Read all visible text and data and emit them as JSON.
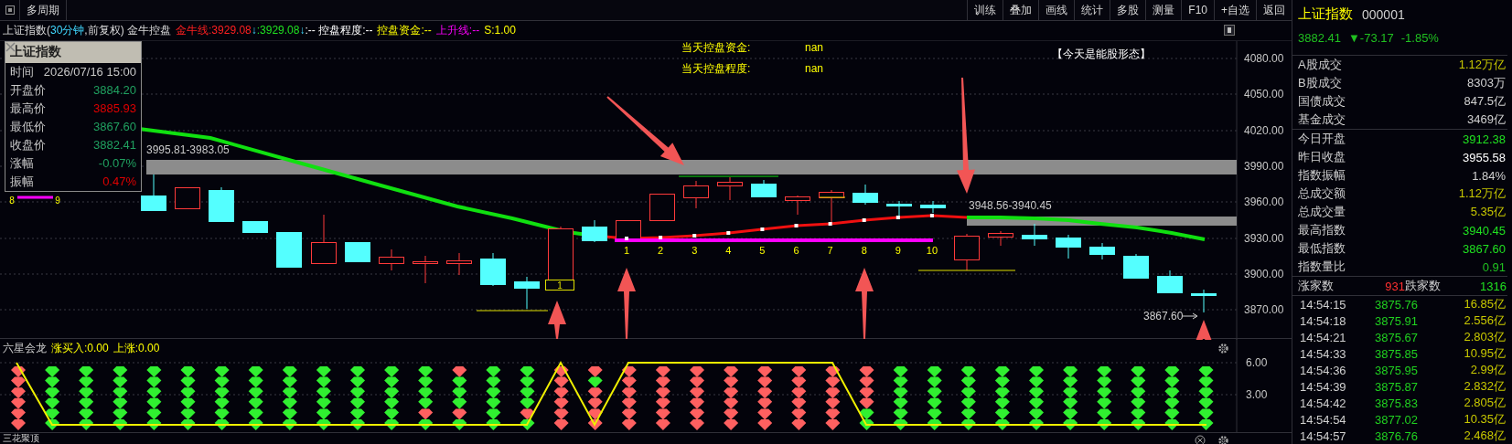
{
  "toolbar": {
    "left_buttons": [
      "多周期"
    ],
    "right_buttons": [
      "训练",
      "叠加",
      "画线",
      "统计",
      "多股",
      "测量",
      "F10",
      "+自选",
      "返回"
    ]
  },
  "chart_title": {
    "segments": [
      {
        "text": "上证指数(",
        "kind": "title"
      },
      {
        "text": "30分钟",
        "kind": "period"
      },
      {
        "text": ",前复权) 金牛控盘",
        "kind": "title"
      },
      {
        "text": "金牛线:3929.08",
        "kind": "line"
      },
      {
        "text": "↓",
        "kind": "arrow"
      },
      {
        "text": ":3929.08",
        "kind": "value"
      },
      {
        "text": "↓",
        "kind": "arrow"
      },
      {
        "text": ":-- 控盘程度:--",
        "kind": "plain"
      },
      {
        "text": "控盘资金:--",
        "kind": "fund"
      },
      {
        "text": "上升线:--",
        "kind": "rise"
      },
      {
        "text": "S:1.00",
        "kind": "fund"
      }
    ]
  },
  "info_box": {
    "title": "上证指数",
    "time_label": "时间",
    "time": "2026/07/16 15:00",
    "rows": [
      {
        "label": "开盘价",
        "value": "3884.20",
        "color": "#20a060"
      },
      {
        "label": "最高价",
        "value": "3885.93",
        "color": "#e00000"
      },
      {
        "label": "最低价",
        "value": "3867.60",
        "color": "#20a060"
      },
      {
        "label": "收盘价",
        "value": "3882.41",
        "color": "#20a060"
      },
      {
        "label": "涨幅",
        "value": "-0.07%",
        "color": "#20a060"
      },
      {
        "label": "振幅",
        "value": "0.47%",
        "color": "#e00000"
      }
    ]
  },
  "main_chart": {
    "notes": [
      {
        "label": "当天控盘资金:",
        "value": "nan"
      },
      {
        "label": "当天控盘程度:",
        "value": "nan"
      }
    ],
    "pattern_note": "【今天是能股形态】",
    "range_labels": [
      "3995.81-3983.05",
      "3948.56-3940.45"
    ],
    "low_label": "3867.60",
    "count_labels": [
      "1",
      "2",
      "3",
      "4",
      "5",
      "6",
      "7",
      "8",
      "9",
      "10"
    ],
    "box_label": "1",
    "side_labels": [
      "8",
      "9"
    ],
    "y_axis": [
      "4080.00",
      "4050.00",
      "4020.00",
      "3990.00",
      "3960.00",
      "3930.00",
      "3900.00",
      "3870.00"
    ]
  },
  "indicator": {
    "name": "六星会龙",
    "values": [
      "涨买入:0.00",
      "上涨:0.00"
    ],
    "y_axis": [
      "6.00",
      "3.00"
    ]
  },
  "next_indicator": {
    "name": "三花聚顶"
  },
  "quote_panel": {
    "name": "上证指数",
    "code": "000001",
    "price": "3882.41",
    "change": "▼-73.17",
    "percent": "-1.85%",
    "groups": [
      [
        {
          "label": "A股成交",
          "value": "1.12万亿",
          "color": "#c8c800"
        },
        {
          "label": "B股成交",
          "value": "8303万",
          "color": "#d0d0d0"
        },
        {
          "label": "国债成交",
          "value": "847.5亿",
          "color": "#d0d0d0"
        },
        {
          "label": "基金成交",
          "value": "3469亿",
          "color": "#d0d0d0"
        }
      ],
      [
        {
          "label": "今日开盘",
          "value": "3912.38",
          "color": "#20e020"
        },
        {
          "label": "昨日收盘",
          "value": "3955.58",
          "color": "#ffffff"
        },
        {
          "label": "指数振幅",
          "value": "1.84%",
          "color": "#d0d0d0"
        },
        {
          "label": "总成交额",
          "value": "1.12万亿",
          "color": "#c8c800"
        },
        {
          "label": "总成交量",
          "value": "5.35亿",
          "color": "#c8c800"
        },
        {
          "label": "最高指数",
          "value": "3940.45",
          "color": "#20e020"
        },
        {
          "label": "最低指数",
          "value": "3867.60",
          "color": "#20e020"
        },
        {
          "label": "指数量比",
          "value": "0.91",
          "color": "#20c020"
        }
      ]
    ],
    "breadth": {
      "up_label": "涨家数",
      "up_count": "931",
      "down_label": "跌家数",
      "down_count": "1316"
    },
    "ticks": [
      {
        "time": "14:54:15",
        "price": "3875.76",
        "volume": "16.85亿"
      },
      {
        "time": "14:54:18",
        "price": "3875.91",
        "volume": "2.556亿"
      },
      {
        "time": "14:54:21",
        "price": "3875.67",
        "volume": "2.803亿"
      },
      {
        "time": "14:54:33",
        "price": "3875.85",
        "volume": "10.95亿"
      },
      {
        "time": "14:54:36",
        "price": "3875.95",
        "volume": "2.99亿"
      },
      {
        "time": "14:54:39",
        "price": "3875.87",
        "volume": "2.832亿"
      },
      {
        "time": "14:54:42",
        "price": "3875.83",
        "volume": "2.805亿"
      },
      {
        "time": "14:54:54",
        "price": "3877.02",
        "volume": "10.35亿"
      },
      {
        "time": "14:54:57",
        "price": "3876.76",
        "volume": "2.468亿"
      }
    ]
  }
}
